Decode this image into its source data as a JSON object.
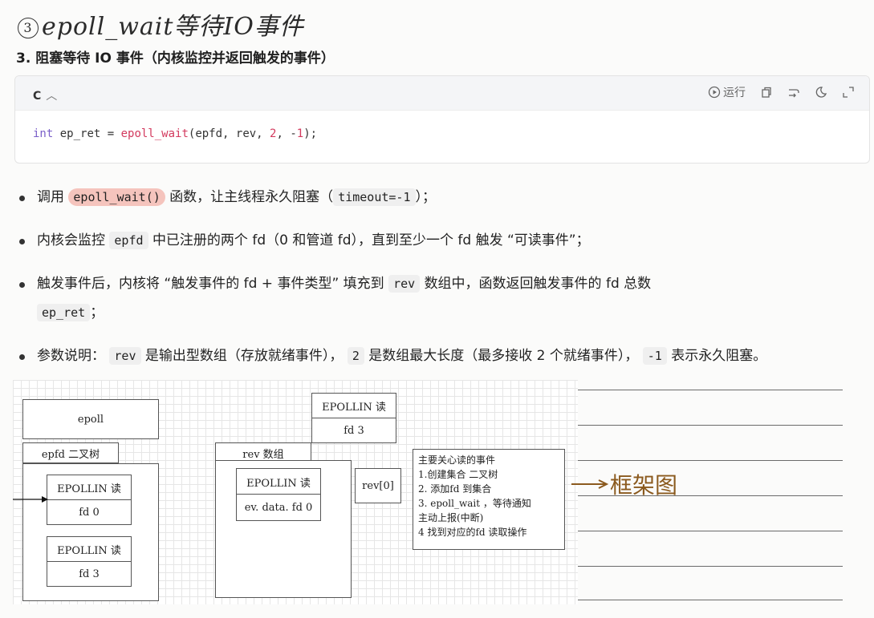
{
  "handwritten_title": {
    "number": "3",
    "text": "epoll_wait等待IO事件"
  },
  "section_heading": "3. 阻塞等待 IO 事件（内核监控并返回触发的事件）",
  "code_block": {
    "language": "C",
    "run_label": "运行",
    "code": {
      "type": "int",
      "lhs": " ep_ret = ",
      "fn": "epoll_wait",
      "args_a": "(epfd, rev, ",
      "n2": "2",
      "args_b": ", -",
      "n1": "1",
      "tail": ");"
    }
  },
  "bullets": {
    "b1": {
      "t1": "调用",
      "c1": "epoll_wait()",
      "t2": "函数，让主线程永久阻塞（",
      "c2": "timeout=-1",
      "t3": "）；"
    },
    "b2": {
      "t1": "内核会监控",
      "c1": "epfd",
      "t2": "中已注册的两个 fd（0 和管道 fd），直到至少一个 fd 触发 “可读事件”；"
    },
    "b3": {
      "t1": "触发事件后，内核将 “触发事件的 fd + 事件类型” 填充到",
      "c1": "rev",
      "t2": "数组中，函数返回触发事件的 fd 总数",
      "c2": "ep_ret",
      "t3": "；"
    },
    "b4": {
      "t1": "参数说明：",
      "c1": "rev",
      "t2": "是输出型数组（存放就绪事件），",
      "c2": "2",
      "t3": "是数组最大长度（最多接收 2 个就绪事件），",
      "c3": "-1",
      "t4": "表示永久阻塞。"
    }
  },
  "diagram": {
    "epoll": "epoll",
    "epfd_tree": "epfd  二叉树",
    "node1": {
      "event": "EPOLLIN 读",
      "fd": "fd 0"
    },
    "node2": {
      "event": "EPOLLIN 读",
      "fd": "fd 3"
    },
    "top_node": {
      "event": "EPOLLIN 读",
      "fd": "fd 3"
    },
    "rev_array": "rev  数组",
    "rev_item": {
      "event": "EPOLLIN 读",
      "fd": "ev. data. fd 0"
    },
    "rev0": "rev[0]",
    "note": [
      "主要关心读的事件",
      "1.创建集合  二叉树",
      "2.  添加fd  到集合",
      "3.  epoll_wait ，等待通知",
      "主动上报(中断)",
      "4  找到对应的fd  读取操作"
    ]
  },
  "handwritten_label": "框架图",
  "colors": {
    "keyword": "#7a5fc9",
    "function": "#d33a5e",
    "highlight": "#f5c4bd",
    "handwriting_brown": "#8b5a1e"
  }
}
